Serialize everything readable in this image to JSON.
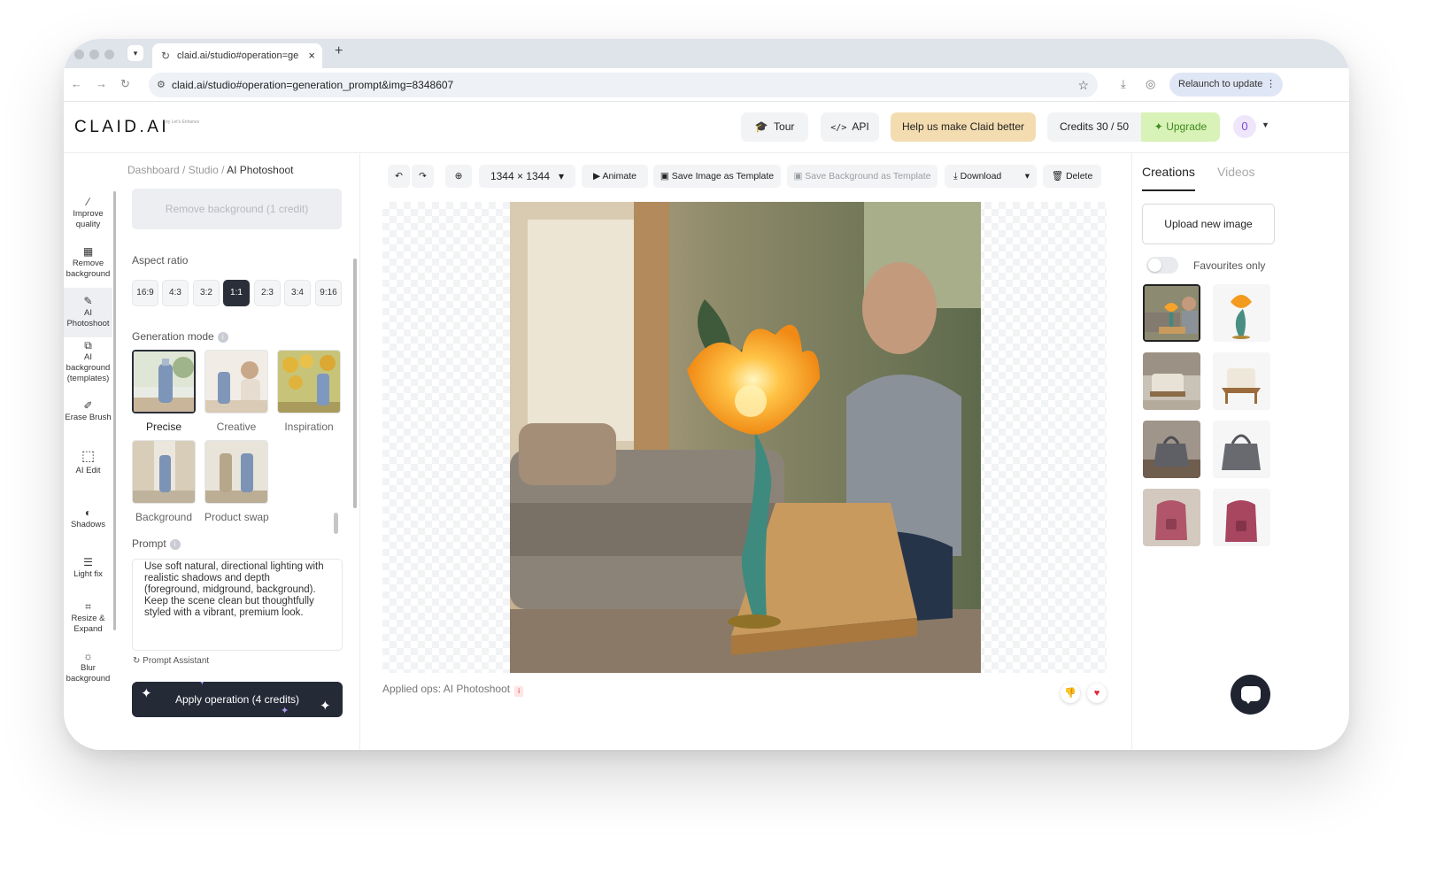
{
  "browser": {
    "tab_title": "claid.ai/studio#operation=ge",
    "url": "claid.ai/studio#operation=generation_prompt&img=8348607",
    "relaunch_label": "Relaunch to update"
  },
  "header": {
    "logo": "CLAID.AI",
    "logo_sub": "by Let's Enhance",
    "tour": "Tour",
    "api": "API",
    "feedback": "Help us make Claid better",
    "credits": "Credits 30 / 50",
    "upgrade": "Upgrade",
    "avatar": "0"
  },
  "rail": [
    {
      "label": "Improve quality",
      "icon": "magic-wand-icon"
    },
    {
      "label": "Remove background",
      "icon": "checker-icon"
    },
    {
      "label": "AI Photoshoot",
      "icon": "pen-icon"
    },
    {
      "label": "AI background (templates)",
      "icon": "image-edit-icon"
    },
    {
      "label": "Erase Brush",
      "icon": "brush-icon"
    },
    {
      "label": "AI Edit",
      "icon": "ai-edit-icon"
    },
    {
      "label": "Shadows",
      "icon": "shadow-icon"
    },
    {
      "label": "Light fix",
      "icon": "sliders-icon"
    },
    {
      "label": "Resize & Expand",
      "icon": "crop-icon"
    },
    {
      "label": "Blur background",
      "icon": "blur-icon"
    }
  ],
  "panel": {
    "breadcrumb": {
      "dashboard": "Dashboard",
      "studio": "Studio",
      "current": "AI Photoshoot"
    },
    "remove_bg": "Remove background (1 credit)",
    "aspect_ratio_label": "Aspect ratio",
    "aspect_ratios": [
      "16:9",
      "4:3",
      "3:2",
      "1:1",
      "2:3",
      "3:4",
      "9:16"
    ],
    "selected_ratio": "1:1",
    "generation_mode_label": "Generation mode",
    "modes": [
      "Precise",
      "Creative",
      "Inspiration",
      "Background",
      "Product swap"
    ],
    "selected_mode": "Precise",
    "prompt_label": "Prompt",
    "prompt_text": "Use soft natural, directional lighting with realistic shadows and depth (foreground, midground, background). Keep the scene clean but thoughtfully styled with a vibrant, premium look.",
    "prompt_assistant": "Prompt Assistant",
    "apply": "Apply operation (4 credits)"
  },
  "toolbar": {
    "size": "1344 × 1344",
    "animate": "Animate",
    "save_template": "Save Image as Template",
    "save_bg_template": "Save Background as Template",
    "download": "Download",
    "delete": "Delete"
  },
  "canvas": {
    "applied_ops": "Applied ops: AI Photoshoot"
  },
  "right": {
    "tabs": [
      "Creations",
      "Videos"
    ],
    "upload": "Upload new image",
    "favourites": "Favourites only",
    "favourites_on": false
  },
  "colors": {
    "accent_dark": "#252a37",
    "feedback_bg": "#f3dcb0",
    "upgrade_bg": "#d9f2b7",
    "upgrade_text": "#3e8a1f"
  }
}
